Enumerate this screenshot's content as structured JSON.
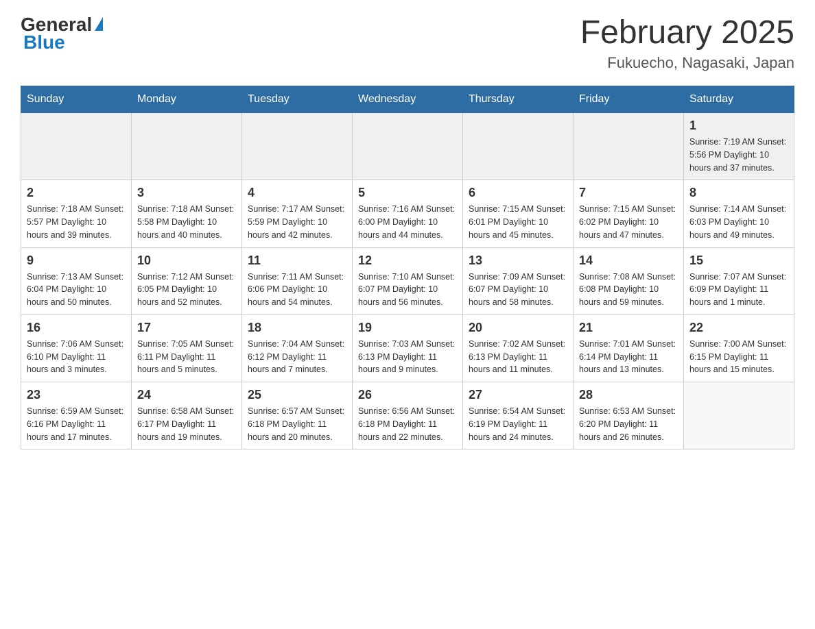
{
  "header": {
    "logo_general": "General",
    "logo_blue": "Blue",
    "month_title": "February 2025",
    "location": "Fukuecho, Nagasaki, Japan"
  },
  "weekdays": [
    "Sunday",
    "Monday",
    "Tuesday",
    "Wednesday",
    "Thursday",
    "Friday",
    "Saturday"
  ],
  "weeks": [
    {
      "days": [
        {
          "num": "",
          "info": ""
        },
        {
          "num": "",
          "info": ""
        },
        {
          "num": "",
          "info": ""
        },
        {
          "num": "",
          "info": ""
        },
        {
          "num": "",
          "info": ""
        },
        {
          "num": "",
          "info": ""
        },
        {
          "num": "1",
          "info": "Sunrise: 7:19 AM\nSunset: 5:56 PM\nDaylight: 10 hours and 37 minutes."
        }
      ]
    },
    {
      "days": [
        {
          "num": "2",
          "info": "Sunrise: 7:18 AM\nSunset: 5:57 PM\nDaylight: 10 hours and 39 minutes."
        },
        {
          "num": "3",
          "info": "Sunrise: 7:18 AM\nSunset: 5:58 PM\nDaylight: 10 hours and 40 minutes."
        },
        {
          "num": "4",
          "info": "Sunrise: 7:17 AM\nSunset: 5:59 PM\nDaylight: 10 hours and 42 minutes."
        },
        {
          "num": "5",
          "info": "Sunrise: 7:16 AM\nSunset: 6:00 PM\nDaylight: 10 hours and 44 minutes."
        },
        {
          "num": "6",
          "info": "Sunrise: 7:15 AM\nSunset: 6:01 PM\nDaylight: 10 hours and 45 minutes."
        },
        {
          "num": "7",
          "info": "Sunrise: 7:15 AM\nSunset: 6:02 PM\nDaylight: 10 hours and 47 minutes."
        },
        {
          "num": "8",
          "info": "Sunrise: 7:14 AM\nSunset: 6:03 PM\nDaylight: 10 hours and 49 minutes."
        }
      ]
    },
    {
      "days": [
        {
          "num": "9",
          "info": "Sunrise: 7:13 AM\nSunset: 6:04 PM\nDaylight: 10 hours and 50 minutes."
        },
        {
          "num": "10",
          "info": "Sunrise: 7:12 AM\nSunset: 6:05 PM\nDaylight: 10 hours and 52 minutes."
        },
        {
          "num": "11",
          "info": "Sunrise: 7:11 AM\nSunset: 6:06 PM\nDaylight: 10 hours and 54 minutes."
        },
        {
          "num": "12",
          "info": "Sunrise: 7:10 AM\nSunset: 6:07 PM\nDaylight: 10 hours and 56 minutes."
        },
        {
          "num": "13",
          "info": "Sunrise: 7:09 AM\nSunset: 6:07 PM\nDaylight: 10 hours and 58 minutes."
        },
        {
          "num": "14",
          "info": "Sunrise: 7:08 AM\nSunset: 6:08 PM\nDaylight: 10 hours and 59 minutes."
        },
        {
          "num": "15",
          "info": "Sunrise: 7:07 AM\nSunset: 6:09 PM\nDaylight: 11 hours and 1 minute."
        }
      ]
    },
    {
      "days": [
        {
          "num": "16",
          "info": "Sunrise: 7:06 AM\nSunset: 6:10 PM\nDaylight: 11 hours and 3 minutes."
        },
        {
          "num": "17",
          "info": "Sunrise: 7:05 AM\nSunset: 6:11 PM\nDaylight: 11 hours and 5 minutes."
        },
        {
          "num": "18",
          "info": "Sunrise: 7:04 AM\nSunset: 6:12 PM\nDaylight: 11 hours and 7 minutes."
        },
        {
          "num": "19",
          "info": "Sunrise: 7:03 AM\nSunset: 6:13 PM\nDaylight: 11 hours and 9 minutes."
        },
        {
          "num": "20",
          "info": "Sunrise: 7:02 AM\nSunset: 6:13 PM\nDaylight: 11 hours and 11 minutes."
        },
        {
          "num": "21",
          "info": "Sunrise: 7:01 AM\nSunset: 6:14 PM\nDaylight: 11 hours and 13 minutes."
        },
        {
          "num": "22",
          "info": "Sunrise: 7:00 AM\nSunset: 6:15 PM\nDaylight: 11 hours and 15 minutes."
        }
      ]
    },
    {
      "days": [
        {
          "num": "23",
          "info": "Sunrise: 6:59 AM\nSunset: 6:16 PM\nDaylight: 11 hours and 17 minutes."
        },
        {
          "num": "24",
          "info": "Sunrise: 6:58 AM\nSunset: 6:17 PM\nDaylight: 11 hours and 19 minutes."
        },
        {
          "num": "25",
          "info": "Sunrise: 6:57 AM\nSunset: 6:18 PM\nDaylight: 11 hours and 20 minutes."
        },
        {
          "num": "26",
          "info": "Sunrise: 6:56 AM\nSunset: 6:18 PM\nDaylight: 11 hours and 22 minutes."
        },
        {
          "num": "27",
          "info": "Sunrise: 6:54 AM\nSunset: 6:19 PM\nDaylight: 11 hours and 24 minutes."
        },
        {
          "num": "28",
          "info": "Sunrise: 6:53 AM\nSunset: 6:20 PM\nDaylight: 11 hours and 26 minutes."
        },
        {
          "num": "",
          "info": ""
        }
      ]
    }
  ]
}
